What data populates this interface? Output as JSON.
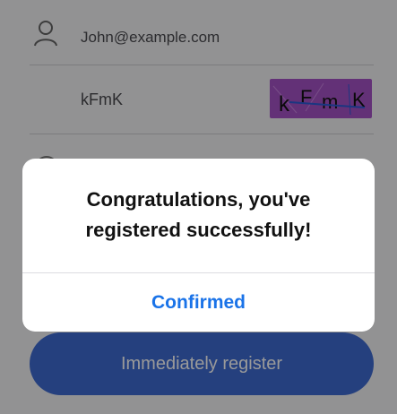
{
  "form": {
    "email_value": "John@example.com",
    "captcha_value": "kFmK",
    "captcha_image": {
      "text_chars": [
        "k",
        "F",
        "m",
        "K"
      ],
      "background_color": "#a653c7",
      "noise_color": "#2d5bd8"
    },
    "register_label": "Immediately register"
  },
  "icons": {
    "email_icon": "user-icon",
    "password_icon": "lock-icon"
  },
  "dialog": {
    "message_line1": "Congratulations, you've",
    "message_line2": "registered successfully!",
    "confirm_label": "Confirmed"
  },
  "colors": {
    "primary": "#3f6bd3",
    "confirm_text": "#1a73e8",
    "overlay": "rgba(0,0,0,0.40)"
  }
}
